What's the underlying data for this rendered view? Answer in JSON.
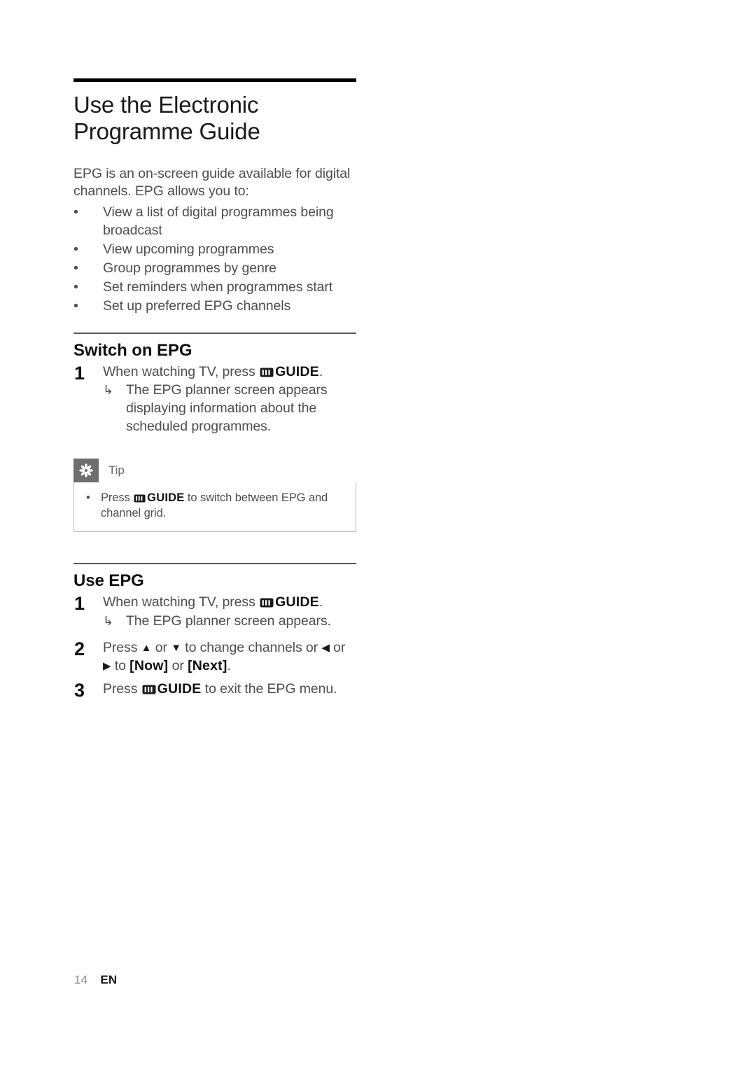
{
  "document": {
    "chapter_title": "Use the Electronic\nProgramme Guide",
    "intro": "EPG is an on-screen guide available for digital channels. EPG allows you to:",
    "bullet_marker": "•",
    "bullets": [
      "View a list of digital programmes being broadcast",
      "View upcoming programmes",
      "Group programmes by genre",
      "Set reminders when programmes start",
      "Set up preferred EPG channels"
    ],
    "icons": {
      "guide_key": "guide-key-icon",
      "tip_badge": "tip-asterisk-icon",
      "result_hook": "↳",
      "arrow_up": "▲",
      "arrow_down": "▼",
      "arrow_left": "◀",
      "arrow_right": "▶"
    },
    "colors": {
      "title_rule": "#000000",
      "section_rule": "#58585a",
      "body_text": "#4e4e4e",
      "heading_text": "#111111",
      "tip_badge_bg": "#6e6e70",
      "tip_border": "#b9b9bb",
      "page_number": "#8c8c8c"
    },
    "sections": [
      {
        "heading": "Switch on EPG",
        "steps": [
          {
            "number": "1",
            "text_before_icon": "When watching TV, press ",
            "key_label": "GUIDE",
            "text_after_icon": ".",
            "result": "The EPG planner screen appears displaying information about the scheduled programmes."
          }
        ]
      },
      {
        "heading": "Use EPG",
        "steps": [
          {
            "number": "1",
            "text_before_icon": "When watching TV, press ",
            "key_label": "GUIDE",
            "text_after_icon": ".",
            "result": "The EPG planner screen appears."
          },
          {
            "number": "2",
            "part1": "Press ",
            "arrow1": "▲",
            "part2": " or ",
            "arrow2": "▼",
            "part3": " to change channels or ",
            "arrow3": "◀",
            "part4": " or ",
            "arrow4": "▶",
            "part5": " to ",
            "bracket1": "[Now]",
            "part6": " or ",
            "bracket2": "[Next]",
            "part7": "."
          },
          {
            "number": "3",
            "text_before_icon": "Press ",
            "key_label": "GUIDE",
            "text_after_icon": " to exit the EPG menu."
          }
        ]
      }
    ],
    "tip": {
      "label": "Tip",
      "bullet_marker": "•",
      "text_before_icon": "Press ",
      "key_label": "GUIDE",
      "text_after_icon": " to switch between EPG and channel grid."
    },
    "footer": {
      "page_number": "14",
      "language": "EN"
    }
  }
}
